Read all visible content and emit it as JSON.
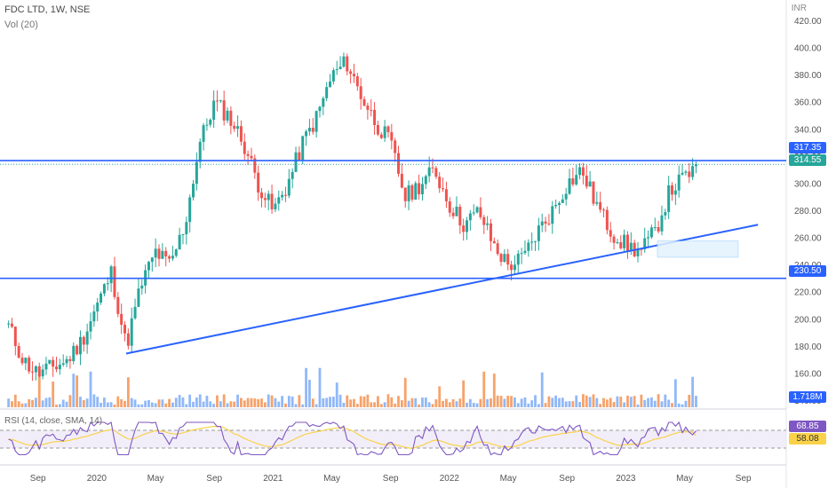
{
  "header": {
    "symbol_line": "FDC LTD, 1W, NSE",
    "vol_label": "Vol (20)",
    "currency": "INR"
  },
  "rsi": {
    "label": "RSI (14, close, SMA, 14)",
    "value_label": "68.85",
    "sma_label": "58.08",
    "rsi_value": 68.85,
    "sma_value": 58.08,
    "upper": 70,
    "lower": 30
  },
  "price_tags": {
    "resistance": "317.35",
    "last": "314.55",
    "support": "230.50",
    "volume": "1.718M"
  },
  "colors": {
    "up": "#26a69a",
    "down": "#ef5350",
    "line": "#2962ff",
    "vol_up": "#90b8f8",
    "vol_down": "#f7a26a",
    "rsi_line": "#7e57c2",
    "rsi_sma": "#f9d24a",
    "box": "#e3f2fd"
  },
  "chart_data": {
    "type": "candlestick",
    "title": "FDC LTD, 1W, NSE",
    "y_axis": {
      "ticks": [
        "420.00",
        "400.00",
        "380.00",
        "360.00",
        "340.00",
        "320.00",
        "300.00",
        "280.00",
        "260.00",
        "240.00",
        "220.00",
        "200.00",
        "180.00",
        "160.00",
        "140.00"
      ],
      "ylim": [
        140,
        420
      ]
    },
    "x_axis": {
      "ticks": [
        "Sep",
        "2020",
        "May",
        "Sep",
        "2021",
        "May",
        "Sep",
        "2022",
        "May",
        "Sep",
        "2023",
        "May",
        "Sep"
      ]
    },
    "levels": [
      {
        "name": "resistance",
        "value": 317.35
      },
      {
        "name": "support",
        "value": 230.5
      }
    ],
    "last_price": 314.55,
    "trendline": {
      "from": [
        "Mar 2020",
        175
      ],
      "to": [
        "Oct 2023",
        270
      ]
    },
    "price_path": [
      [
        "Jul 2019",
        195
      ],
      [
        "Aug 2019",
        170
      ],
      [
        "Sep 2019",
        160
      ],
      [
        "Oct 2019",
        165
      ],
      [
        "Nov 2019",
        170
      ],
      [
        "Dec 2019",
        185
      ],
      [
        "Jan 2020",
        210
      ],
      [
        "Feb 2020",
        235
      ],
      [
        "Mar 2020",
        180
      ],
      [
        "Apr 2020",
        225
      ],
      [
        "May 2020",
        250
      ],
      [
        "Jun 2020",
        240
      ],
      [
        "Jul 2020",
        270
      ],
      [
        "Aug 2020",
        330
      ],
      [
        "Sep 2020",
        360
      ],
      [
        "Oct 2020",
        350
      ],
      [
        "Nov 2020",
        330
      ],
      [
        "Dec 2020",
        300
      ],
      [
        "Jan 2021",
        280
      ],
      [
        "Feb 2021",
        300
      ],
      [
        "Mar 2021",
        330
      ],
      [
        "Apr 2021",
        350
      ],
      [
        "May 2021",
        380
      ],
      [
        "Jun 2021",
        390
      ],
      [
        "Jul 2021",
        365
      ],
      [
        "Aug 2021",
        345
      ],
      [
        "Sep 2021",
        330
      ],
      [
        "Oct 2021",
        290
      ],
      [
        "Nov 2021",
        300
      ],
      [
        "Dec 2021",
        310
      ],
      [
        "Jan 2022",
        285
      ],
      [
        "Feb 2022",
        270
      ],
      [
        "Mar 2022",
        280
      ],
      [
        "Apr 2022",
        255
      ],
      [
        "May 2022",
        240
      ],
      [
        "Jun 2022",
        245
      ],
      [
        "Jul 2022",
        265
      ],
      [
        "Aug 2022",
        280
      ],
      [
        "Sep 2022",
        300
      ],
      [
        "Oct 2022",
        310
      ],
      [
        "Nov 2022",
        285
      ],
      [
        "Dec 2022",
        265
      ],
      [
        "Jan 2023",
        255
      ],
      [
        "Feb 2023",
        250
      ],
      [
        "Mar 2023",
        265
      ],
      [
        "Apr 2023",
        295
      ],
      [
        "May 2023",
        305
      ],
      [
        "Jun 2023",
        314
      ]
    ]
  }
}
